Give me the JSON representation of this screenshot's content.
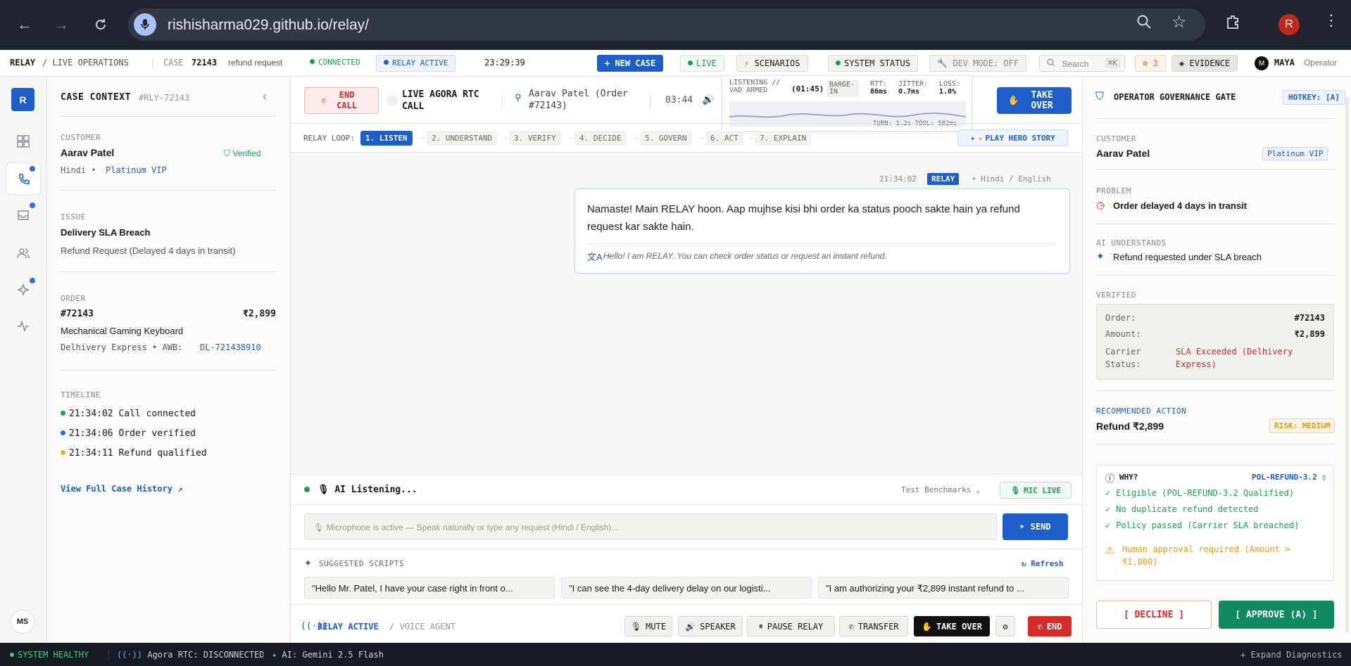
{
  "browser": {
    "url": "rishisharma029.github.io/relay/",
    "avatar_letter": "R"
  },
  "header": {
    "brand": "RELAY",
    "section": "/ LIVE OPERATIONS",
    "case_label": "CASE",
    "case_number": "72143",
    "case_type": "refund request",
    "connected": "CONNECTED",
    "relay_active": "RELAY ACTIVE",
    "clock": "23:29:39",
    "new_case": "+ NEW CASE",
    "live": "LIVE",
    "scenarios": "SCENARIOS",
    "system_status": "SYSTEM STATUS",
    "dev_mode": "DEV MODE: OFF",
    "search_placeholder": "Search",
    "search_shortcut": "⌘K",
    "alerts_count": "3",
    "evidence": "EVIDENCE",
    "operator_initial": "M",
    "operator_name": "MAYA",
    "operator_role": "Operator"
  },
  "rail": {
    "logo": "R",
    "user_initials": "MS"
  },
  "case_context": {
    "title": "CASE CONTEXT",
    "case_id": "#RLY-72143",
    "customer_label": "CUSTOMER",
    "customer_name": "Aarav Patel",
    "verified": "Verified",
    "language": "Hindi •",
    "tier": "Platinum VIP",
    "issue_label": "ISSUE",
    "issue_title": "Delivery SLA Breach",
    "issue_detail": "Refund Request (Delayed 4 days in transit)",
    "order_label": "ORDER",
    "order_number": "#72143",
    "order_amount": "₹2,899",
    "order_item": "Mechanical Gaming Keyboard",
    "carrier": "Delhivery Express • AWB:",
    "awb": "DL-721438910",
    "timeline_label": "TIMELINE",
    "timeline": [
      {
        "text": "21:34:02 Call connected",
        "color": "#1f9d55"
      },
      {
        "text": "21:34:06 Order verified",
        "color": "#2f6de0"
      },
      {
        "text": "21:34:11 Refund qualified",
        "color": "#e5b12b"
      }
    ],
    "history_link": "View Full Case History"
  },
  "call": {
    "end_call": "END CALL",
    "call_title": "LIVE AGORA RTC CALL",
    "caller": "Aarav Patel (Order #72143)",
    "duration": "03:44",
    "take_over": "TAKE OVER",
    "telemetry": {
      "state": "LISTENING // VAD ARMED",
      "timer": "(01:45)",
      "barge": "BARGE-IN",
      "rtt_label": "RTT:",
      "rtt": "86ms",
      "jitter_label": "JITTER:",
      "jitter": "0.7ms",
      "loss_label": "LOSS:",
      "loss": "1.0%",
      "turn": "TURN: 1.2s TOOL: 582ms"
    }
  },
  "relay_loop": {
    "label": "RELAY LOOP:",
    "steps": [
      "1. LISTEN",
      "2. UNDERSTAND",
      "3. VERIFY",
      "4. DECIDE",
      "5. GOVERN",
      "6. ACT",
      "7. EXPLAIN"
    ],
    "play_hero": "PLAY HERO STORY"
  },
  "message": {
    "time": "21:34:02",
    "speaker": "RELAY",
    "langs": "• Hindi / English",
    "text": "Namaste! Main RELAY hoon. Aap mujhse kisi bhi order ka status pooch sakte hain ya refund request kar sakte hain.",
    "translation": "Hello! I am RELAY. You can check order status or request an instant refund."
  },
  "listening": {
    "status": "🎙 AI Listening...",
    "benchmarks": "Test Benchmarks",
    "mic_live": "MIC LIVE",
    "input_placeholder": "🎙 Microphone is active — Speak naturally or type any request (Hindi / English)...",
    "send": "SEND"
  },
  "scripts": {
    "title": "SUGGESTED SCRIPTS",
    "refresh": "Refresh",
    "items": [
      "\"Hello Mr. Patel, I have your case right in front o...",
      "\"I can see the 4-day delivery delay on our logisti...",
      "\"I am authorizing your ₹2,899 instant refund to ..."
    ]
  },
  "controls": {
    "relay_active": "RELAY ACTIVE",
    "voice_agent": "/ VOICE AGENT",
    "mute": "MUTE",
    "speaker": "SPEAKER",
    "pause": "PAUSE RELAY",
    "transfer": "TRANSFER",
    "take_over": "TAKE OVER",
    "end": "END"
  },
  "governance": {
    "title": "OPERATOR GOVERNANCE GATE",
    "hotkey": "HOTKEY: [A]",
    "customer_label": "CUSTOMER",
    "customer_name": "Aarav Patel",
    "tier": "Platinum VIP",
    "problem_label": "PROBLEM",
    "problem": "Order delayed 4 days in transit",
    "ai_label": "AI UNDERSTANDS",
    "ai_understands": "Refund requested under SLA breach",
    "verified_label": "VERIFIED",
    "order_key": "Order:",
    "order_val": "#72143",
    "amount_key": "Amount:",
    "amount_val": "₹2,899",
    "carrier_key": "Carrier Status:",
    "carrier_val": "SLA Exceeded (Delhivery Express)",
    "recommended_label": "RECOMMENDED ACTION",
    "recommended": "Refund ₹2,899",
    "risk": "RISK: MEDIUM",
    "why": "WHY?",
    "policy": "POL-REFUND-3.2",
    "checks": [
      "Eligible (POL-REFUND-3.2 Qualified)",
      "No duplicate refund detected",
      "Policy passed (Carrier SLA breached)"
    ],
    "warning": "Human approval required (Amount > ₹1,000)",
    "decline": "[ DECLINE ]",
    "approve": "[ APPROVE (A) ]"
  },
  "statusbar": {
    "health": "SYSTEM HEALTHY",
    "agora": "Agora RTC: DISCONNECTED",
    "ai": "AI: Gemini 2.5 Flash",
    "expand": "+ Expand Diagnostics"
  },
  "colors": {
    "accent": "#1e5ec8",
    "danger": "#d62b2b",
    "success": "#0f8a5f",
    "warning": "#e59a14"
  }
}
